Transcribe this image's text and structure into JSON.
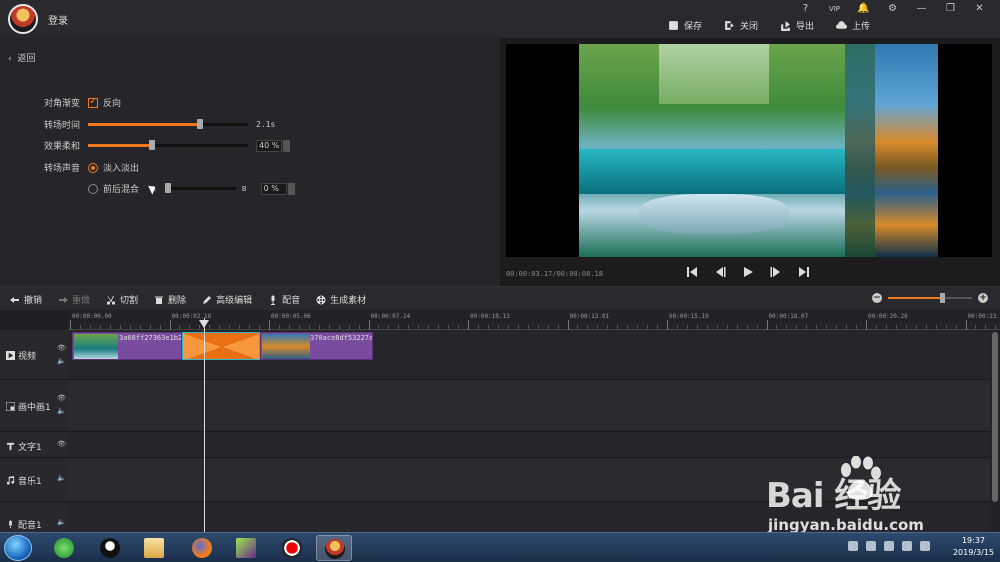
{
  "header": {
    "login": "登录",
    "window_controls": [
      "?",
      "VIP",
      "🔔",
      "⚙",
      "—",
      "❐",
      "✕"
    ],
    "actions": {
      "save": "保存",
      "close": "关闭",
      "export": "导出",
      "upload": "上传"
    }
  },
  "settings": {
    "back": "返回",
    "diagonal_label": "对角渐变",
    "reverse_label": "反向",
    "reverse_checked": true,
    "transition_time_label": "转场时间",
    "transition_time_value": "2.1s",
    "transition_time_level": 0.7,
    "softness_label": "效果柔和",
    "softness_value": "40 %",
    "softness_level": 0.4,
    "sound_label": "转场声音",
    "fade_label": "淡入淡出",
    "fade_selected": true,
    "mix_label": "前后混合",
    "mix_a": "A",
    "mix_b": "B",
    "mix_value": "0 %",
    "mix_level": 0.0
  },
  "preview": {
    "timecode": "00:00:03.17/00:00:08.18"
  },
  "timeline_toolbar": {
    "undo": "撤销",
    "redo": "重做",
    "cut": "切割",
    "delete": "删除",
    "advanced": "高级编辑",
    "dub": "配音",
    "generate": "生成素材",
    "zoom_level": 0.65
  },
  "ruler": [
    "00:00:00.00",
    "00:00:02.18",
    "00:00:05.06",
    "00:00:07.24",
    "00:00:10.13",
    "00:00:13.01",
    "00:00:15.19",
    "00:00:18.07",
    "00:00:20.26",
    "00:00:23."
  ],
  "tracks": [
    {
      "name": "视频",
      "icon": "play-square-icon"
    },
    {
      "name": "画中画1",
      "icon": "pip-icon"
    },
    {
      "name": "文字1",
      "icon": "text-icon"
    },
    {
      "name": "音乐1",
      "icon": "music-icon"
    },
    {
      "name": "配音1",
      "icon": "mic-icon"
    }
  ],
  "clips": {
    "clip1_text": "3a68ff27363e1b2",
    "clip2_text": "370ace8df53227a"
  },
  "watermark": {
    "big": "Bai  经验",
    "small": "jingyan.baidu.com"
  },
  "taskbar": {
    "time": "19:37",
    "date": "2019/3/15"
  },
  "colors": {
    "accent": "#f07a1d",
    "clip": "#7a4ca0",
    "transition_border": "#2fb5d0"
  }
}
